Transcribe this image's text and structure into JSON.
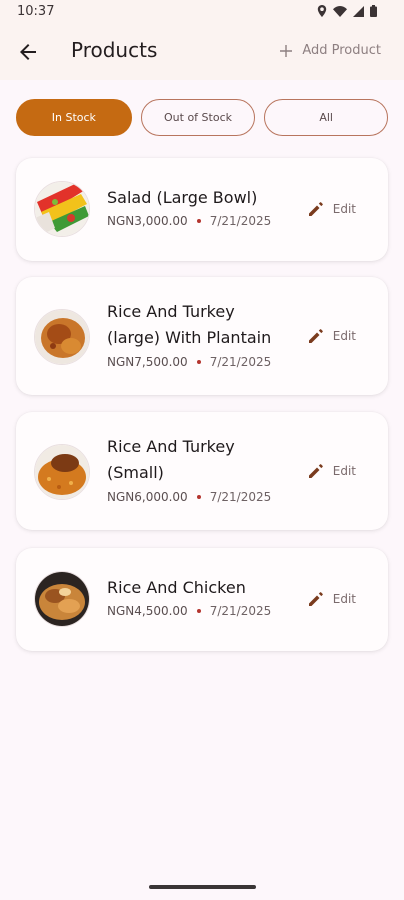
{
  "status": {
    "time": "10:37"
  },
  "appbar": {
    "title": "Products",
    "add_label": "Add Product"
  },
  "tabs": [
    {
      "label": "In Stock",
      "active": true
    },
    {
      "label": "Out of Stock",
      "active": false
    },
    {
      "label": "All",
      "active": false
    }
  ],
  "products": [
    {
      "name": "Salad (Large Bowl)",
      "price": "NGN3,000.00",
      "date": "7/21/2025",
      "edit_label": "Edit"
    },
    {
      "name": "Rice And Turkey (large) With Plantain",
      "price": "NGN7,500.00",
      "date": "7/21/2025",
      "edit_label": "Edit"
    },
    {
      "name": "Rice And Turkey (Small)",
      "price": "NGN6,000.00",
      "date": "7/21/2025",
      "edit_label": "Edit"
    },
    {
      "name": "Rice And Chicken",
      "price": "NGN4,500.00",
      "date": "7/21/2025",
      "edit_label": "Edit"
    }
  ],
  "colors": {
    "accent": "#c56a12",
    "tab_border": "#b8755e",
    "price_dot": "#b4352f",
    "edit_icon": "#7a3b1e"
  }
}
